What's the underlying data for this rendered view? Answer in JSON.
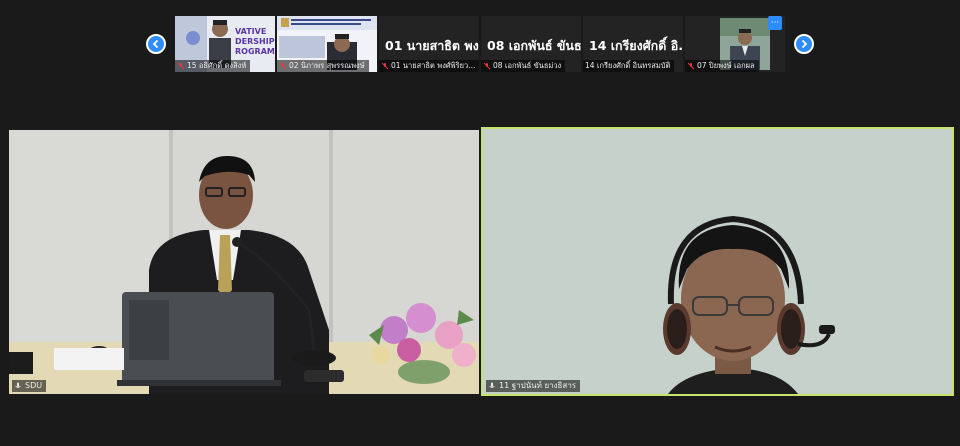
{
  "filmstrip": {
    "thumbnails": [
      {
        "label": "15 อธิศักดิ์ ดงสิงห์",
        "big_name": "",
        "muted": true,
        "has_video": true,
        "banner_text": "VATIVE\nDERSHIP\nROGRAM"
      },
      {
        "label": "02 นิภาพร สุพรรณพงษ์",
        "big_name": "",
        "muted": true,
        "has_video": true
      },
      {
        "label": "01 นายสาธิต พงศ์พิริยว...",
        "big_name": "01 นายสาธิต พง...",
        "muted": true,
        "has_video": false
      },
      {
        "label": "08 เอกพันธ์ ขันธม่วง",
        "big_name": "08 เอกพันธ์ ขันธ...",
        "muted": true,
        "has_video": false
      },
      {
        "label": "14 เกรียงศักดิ์ อินทรสมบัติ",
        "big_name": "14 เกรียงศักดิ์ อิ...",
        "muted": false,
        "has_video": false
      },
      {
        "label": "07 ปิยพงษ์ เอกผล",
        "big_name": "",
        "muted": true,
        "has_video": true
      }
    ],
    "more_icon": "···"
  },
  "video_tiles": [
    {
      "name": "SDU",
      "muted": false,
      "speaking": false
    },
    {
      "name": "11 ฐาปนันท์ ยางธิสาร",
      "muted": false,
      "speaking": true
    }
  ],
  "colors": {
    "background": "#1a1a1a",
    "accent": "#2d8cff",
    "active_speaker_border": "#c6e26a",
    "mute_icon": "#e8383d"
  }
}
